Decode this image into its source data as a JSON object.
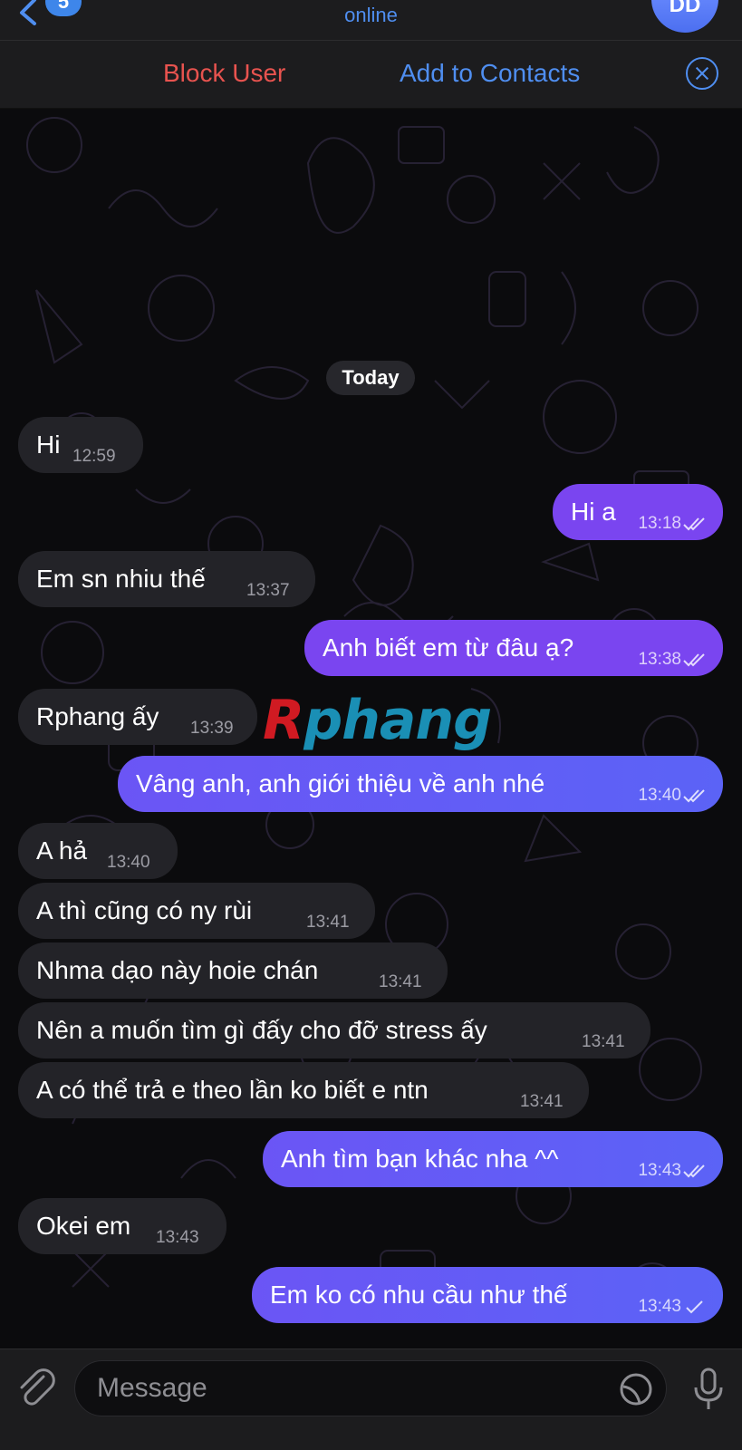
{
  "header": {
    "back_badge": "5",
    "status": "online",
    "avatar_initials": "DD"
  },
  "actions": {
    "block_user": "Block User",
    "add_to_contacts": "Add to Contacts"
  },
  "date_separator": "Today",
  "watermark": {
    "first": "R",
    "rest": "phang"
  },
  "messages": [
    {
      "dir": "in",
      "text": "Hi",
      "time": "12:59"
    },
    {
      "dir": "out",
      "text": "Hi a",
      "time": "13:18",
      "read": true
    },
    {
      "dir": "in",
      "text": "Em sn nhiu thế",
      "time": "13:37"
    },
    {
      "dir": "out",
      "text": "Anh biết em từ đâu ạ?",
      "time": "13:38",
      "read": true
    },
    {
      "dir": "in",
      "text": "Rphang ấy",
      "time": "13:39"
    },
    {
      "dir": "out",
      "text": "Vâng anh, anh giới thiệu về anh nhé",
      "time": "13:40",
      "read": true
    },
    {
      "dir": "in",
      "text": "A hả",
      "time": "13:40"
    },
    {
      "dir": "in",
      "text": "A thì cũng có ny rùi",
      "time": "13:41"
    },
    {
      "dir": "in",
      "text": "Nhma dạo này hoie chán",
      "time": "13:41"
    },
    {
      "dir": "in",
      "text": "Nên a muốn tìm gì đấy cho đỡ stress ấy",
      "time": "13:41"
    },
    {
      "dir": "in",
      "text": "A có thể trả e theo lần ko biết e ntn",
      "time": "13:41"
    },
    {
      "dir": "out",
      "text": "Anh tìm bạn khác nha ^^",
      "time": "13:43",
      "read": true
    },
    {
      "dir": "in",
      "text": "Okei em",
      "time": "13:43"
    },
    {
      "dir": "out",
      "text": "Em ko có nhu cầu như thế",
      "time": "13:43",
      "read": false
    }
  ],
  "composer": {
    "placeholder": "Message"
  },
  "colors": {
    "outgoing_bubble": "#7a45f0",
    "incoming_bubble": "#232328",
    "accent_blue": "#4f8ef0",
    "destructive_red": "#e8534f"
  }
}
